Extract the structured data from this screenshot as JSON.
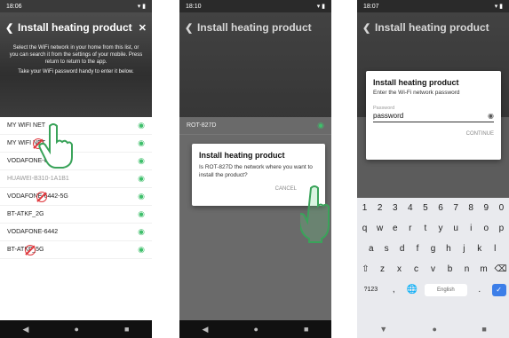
{
  "screens": [
    {
      "status_time": "18:06",
      "status_icons": "▾ ▮",
      "title": "Install heating product",
      "description": "Select the WiFi network in your home from this list, or you can search it from the settings of your mobile. Press return to return to the app.",
      "tip": "Take your WiFi password handy to enter it below.",
      "networks": [
        "MY WIFI NET",
        "MY WIFI NET",
        "VODAFONE-6442",
        "HUAWEI-B310-1A1B1",
        "VODAFONE-6442-5G",
        "BT-ATKF_2G",
        "VODAFONE-6442",
        "BT-ATKF_5G"
      ]
    },
    {
      "status_time": "18:10",
      "status_icons": "▾ ▮",
      "title": "Install heating product",
      "network_row": "ROT-827D",
      "dialog_title": "Install heating product",
      "dialog_text": "Is ROT-827D the network where you want to install the product?",
      "cancel_label": "CANCEL"
    },
    {
      "status_time": "18:07",
      "status_icons": "▾ ▮",
      "title": "Install heating product",
      "dialog_title": "Install heating product",
      "dialog_text": "Enter the Wi-Fi network password",
      "field_label": "Password",
      "field_value": "password",
      "continue_label": "CONTINUE",
      "keyboard": {
        "numbers": [
          "1",
          "2",
          "3",
          "4",
          "5",
          "6",
          "7",
          "8",
          "9",
          "0"
        ],
        "row1": [
          "q",
          "w",
          "e",
          "r",
          "t",
          "y",
          "u",
          "i",
          "o",
          "p"
        ],
        "row2": [
          "a",
          "s",
          "d",
          "f",
          "g",
          "h",
          "j",
          "k",
          "l"
        ],
        "row3": [
          "z",
          "x",
          "c",
          "v",
          "b",
          "n",
          "m"
        ],
        "mode_key": "?123",
        "comma_key": ",",
        "space_label": "English",
        "period_key": "."
      }
    }
  ],
  "navbar": {
    "back": "◀",
    "home": "●",
    "recents": "■"
  },
  "icons": {
    "wifi": "wifi-icon",
    "close": "close-icon",
    "back": "back-arrow-icon",
    "eye": "eye-icon",
    "shift": "shift-icon",
    "backspace": "backspace-icon",
    "globe": "globe-icon",
    "enter": "enter-icon"
  },
  "colors": {
    "wifi": "#3fbf6b",
    "marker": "#e0393e",
    "hand": "#3aa35a",
    "enter": "#3c7ee8"
  }
}
